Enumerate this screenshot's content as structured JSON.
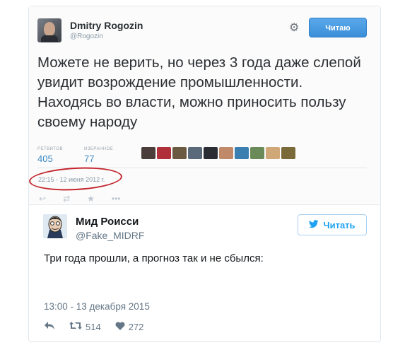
{
  "embedded_tweet": {
    "author_name": "Dmitry Rogozin",
    "author_handle": "@Rogozin",
    "follow_label": "Читаю",
    "text": "Можете не верить, но через 3 года даже слепой увидит возрождение промышленности. Находясь во власти, можно приносить пользу своему народу",
    "retweets_label": "РЕТВИТОВ",
    "retweets": "405",
    "favorites_label": "ИЗБРАННОЕ",
    "favorites": "77",
    "timestamp": "22:15 - 12 июня 2012 г.",
    "circle_color": "#c4262e",
    "actions": [
      "reply-icon",
      "retweet-icon",
      "more-icon"
    ],
    "thumb_colors": [
      "#4a3d3a",
      "#b0303a",
      "#6b5a42",
      "#5b6a7a",
      "#2a2d33",
      "#c08a6a",
      "#3a7fb0",
      "#6a8a5a",
      "#d0a878",
      "#7a6a3a"
    ]
  },
  "tweet": {
    "author_name": "Мид Роисси",
    "author_handle": "@Fake_MIDRF",
    "follow_label": "Читать",
    "text": "Три года прошли, а прогноз так и не сбылся:",
    "timestamp": "13:00 - 13 декабря 2015",
    "retweets": "514",
    "likes": "272",
    "accent": "#1da1f2"
  }
}
